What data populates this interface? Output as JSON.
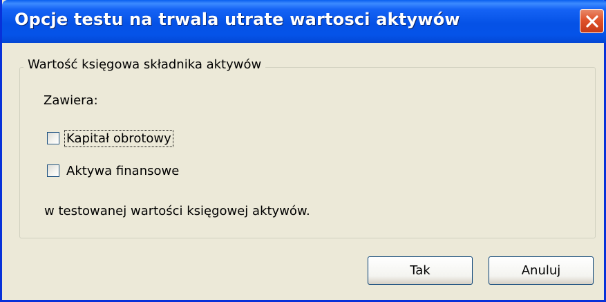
{
  "window": {
    "title": "Opcje testu na trwala utrate wartosci aktywów"
  },
  "titlebar_controls": {
    "close_icon": "close-icon"
  },
  "group": {
    "legend": "Wartość księgowa składnika aktywów",
    "contains_label": "Zawiera:",
    "options": [
      {
        "label": "Kapitał obrotowy",
        "checked": false,
        "focused": true
      },
      {
        "label": "Aktywa finansowe",
        "checked": false,
        "focused": false
      }
    ],
    "footer_text": "w testowanej wartości księgowej aktywów."
  },
  "buttons": {
    "ok_label": "Tak",
    "cancel_label": "Anuluj"
  },
  "colors": {
    "titlebar": "#0553E8",
    "dialog_background": "#ECE9D8",
    "close_button": "#E0532B"
  }
}
